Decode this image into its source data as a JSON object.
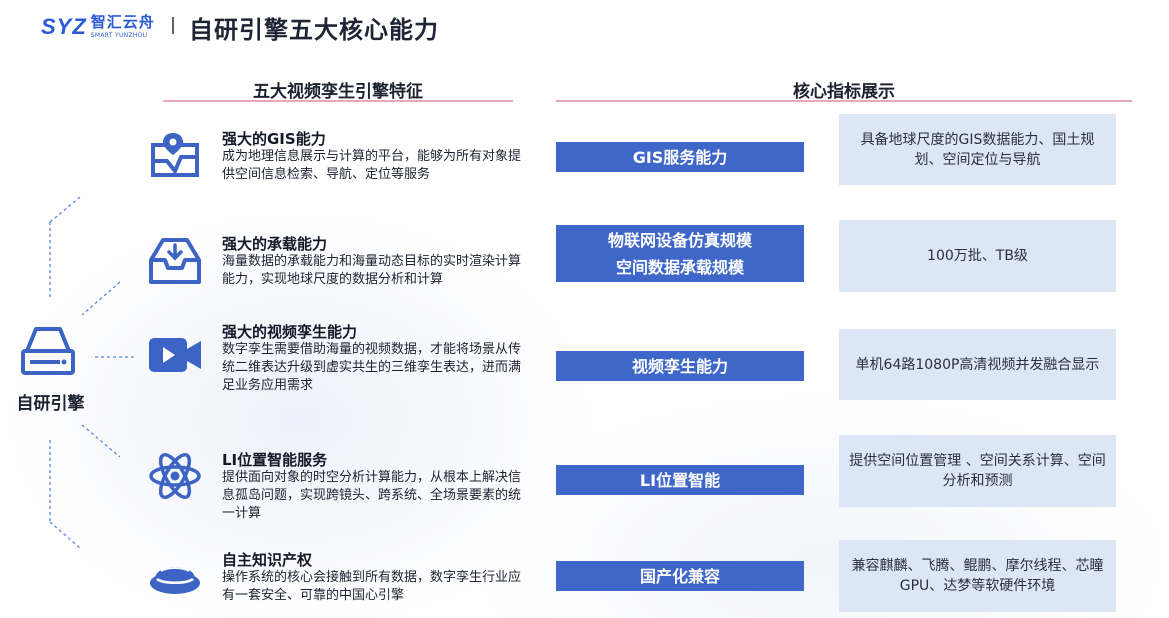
{
  "header": {
    "logo_mark": "SYZ",
    "logo_cn": "智汇云舟",
    "logo_en": "SMART YUNZHOU",
    "title": "自研引擎五大核心能力"
  },
  "sections": {
    "left_title": "五大视频孪生引擎特征",
    "right_title": "核心指标展示"
  },
  "hub": {
    "label": "自研引擎",
    "icon": "engine-box-icon"
  },
  "features": [
    {
      "icon": "map-pin-icon",
      "title": "强大的GIS能力",
      "desc": "成为地理信息展示与计算的平台，能够为所有对象提供空间信息检索、导航、定位等服务"
    },
    {
      "icon": "inbox-tray-icon",
      "title": "强大的承载能力",
      "desc": "海量数据的承载能力和海量动态目标的实时渲染计算能力，实现地球尺度的数据分析和计算"
    },
    {
      "icon": "video-camera-icon",
      "title": "强大的视频孪生能力",
      "desc": "数字孪生需要借助海量的视频数据，才能将场景从传统二维表达升级到虚实共生的三维孪生表达，进而满足业务应用需求"
    },
    {
      "icon": "atom-orbit-icon",
      "title": "LI位置智能服务",
      "desc": "提供面向对象的时空分析计算能力，从根本上解决信息孤岛问题，实现跨镜头、跨系统、全场景要素的统一计算"
    },
    {
      "icon": "dome-disc-icon",
      "title": "自主知识产权",
      "desc": "操作系统的核心会接触到所有数据，数字孪生行业应有一套安全、可靠的中国心引擎"
    }
  ],
  "metrics": [
    {
      "label_lines": [
        "GIS服务能力"
      ],
      "value": "具备地球尺度的GIS数据能力、国土规划、空间定位与导航"
    },
    {
      "label_lines": [
        "物联网设备仿真规模",
        "空间数据承载规模"
      ],
      "value": "100万批、TB级"
    },
    {
      "label_lines": [
        "视频孪生能力"
      ],
      "value": "单机64路1080P高清视频并发融合显示"
    },
    {
      "label_lines": [
        "LI位置智能"
      ],
      "value": "提供空间位置管理 、空间关系计算、空间分析和预测"
    },
    {
      "label_lines": [
        "国产化兼容"
      ],
      "value": "兼容麒麟、飞腾、鲲鹏、摩尔线程、芯瞳GPU、达梦等软硬件环境"
    }
  ],
  "colors": {
    "accent_blue": "#3f67c9",
    "value_bg": "#dce6f5",
    "section_line": "#e9a7b7",
    "icon_blue": "#3d64c5"
  }
}
